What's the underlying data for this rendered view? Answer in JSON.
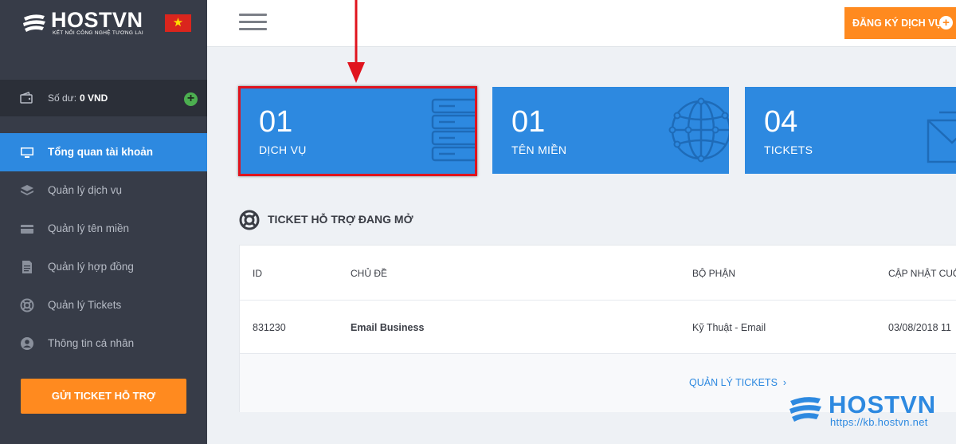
{
  "sidebar": {
    "logo": {
      "brand": "HOSTVN",
      "tagline": "KẾT NỐI CÔNG NGHỆ TƯƠNG LAI",
      "icon": "hostvn-logo-icon"
    },
    "flag_icon": "vietnam-flag-icon",
    "balance": {
      "label": "Số dư:",
      "value": "0 VND",
      "add_icon": "plus-circle-icon"
    },
    "items": [
      {
        "label": "Tổng quan tài khoản",
        "icon": "monitor-icon",
        "active": true
      },
      {
        "label": "Quản lý dịch vụ",
        "icon": "layers-icon",
        "active": false
      },
      {
        "label": "Quản lý tên miền",
        "icon": "card-icon",
        "active": false
      },
      {
        "label": "Quản lý hợp đồng",
        "icon": "document-icon",
        "active": false
      },
      {
        "label": "Quản lý Tickets",
        "icon": "lifebuoy-icon",
        "active": false
      },
      {
        "label": "Thông tin cá nhân",
        "icon": "user-icon",
        "active": false
      }
    ],
    "support_button": "GỬI TICKET HỖ TRỢ"
  },
  "header": {
    "menu_icon": "hamburger-icon",
    "register_button": "ĐĂNG KÝ DỊCH VỤ"
  },
  "cards": [
    {
      "number": "01",
      "label": "DỊCH VỤ",
      "icon": "server-icon"
    },
    {
      "number": "01",
      "label": "TÊN MIỀN",
      "icon": "globe-icon"
    },
    {
      "number": "04",
      "label": "TICKETS",
      "icon": "envelope-icon"
    }
  ],
  "tickets": {
    "title": "TICKET HỖ TRỢ ĐANG MỞ",
    "columns": [
      "ID",
      "CHỦ ĐỀ",
      "BỘ PHẬN",
      "CẬP NHẬT CUỐ"
    ],
    "rows": [
      {
        "id": "831230",
        "subject": "Email Business",
        "department": "Kỹ Thuật - Email",
        "updated": "03/08/2018 11"
      }
    ],
    "manage_link": "QUẢN LÝ TICKETS"
  },
  "watermark": {
    "brand": "HOSTVN",
    "url": "https://kb.hostvn.net"
  },
  "colors": {
    "sidebar": "#373c48",
    "accent_blue": "#2d89e0",
    "accent_orange": "#ff8a1f",
    "highlight_red": "#e0141e"
  }
}
